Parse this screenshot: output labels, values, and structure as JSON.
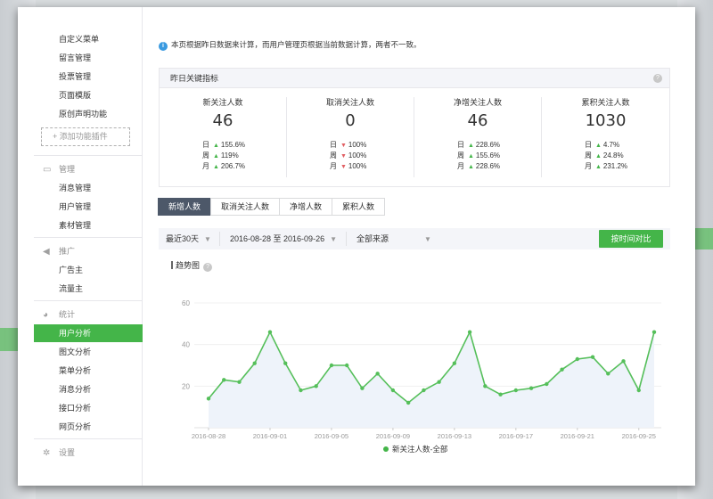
{
  "sidebar": {
    "top_items": [
      {
        "label": "自定义菜单"
      },
      {
        "label": "留言管理"
      },
      {
        "label": "投票管理"
      },
      {
        "label": "页面模版"
      },
      {
        "label": "原创声明功能"
      }
    ],
    "add_plugin_label": "+ 添加功能插件",
    "sections": [
      {
        "heading": "管理",
        "icon": "inbox-icon",
        "items": [
          {
            "label": "消息管理"
          },
          {
            "label": "用户管理"
          },
          {
            "label": "素材管理"
          }
        ]
      },
      {
        "heading": "推广",
        "icon": "megaphone-icon",
        "items": [
          {
            "label": "广告主"
          },
          {
            "label": "流量主"
          }
        ]
      },
      {
        "heading": "统计",
        "icon": "pie-chart-icon",
        "items": [
          {
            "label": "用户分析",
            "active": true
          },
          {
            "label": "图文分析"
          },
          {
            "label": "菜单分析"
          },
          {
            "label": "消息分析"
          },
          {
            "label": "接口分析"
          },
          {
            "label": "网页分析"
          }
        ]
      },
      {
        "heading": "设置",
        "icon": "gear-icon",
        "items": []
      }
    ]
  },
  "notice": "本页根据昨日数据来计算，而用户管理页根据当前数据计算，两者不一致。",
  "kpi": {
    "title": "昨日关键指标",
    "cards": [
      {
        "name": "新关注人数",
        "value": "46",
        "rows": [
          {
            "label": "日",
            "dir": "up",
            "pct": "155.6%"
          },
          {
            "label": "周",
            "dir": "up",
            "pct": "119%"
          },
          {
            "label": "月",
            "dir": "up",
            "pct": "206.7%"
          }
        ]
      },
      {
        "name": "取消关注人数",
        "value": "0",
        "rows": [
          {
            "label": "日",
            "dir": "down",
            "pct": "100%"
          },
          {
            "label": "周",
            "dir": "down",
            "pct": "100%"
          },
          {
            "label": "月",
            "dir": "down",
            "pct": "100%"
          }
        ]
      },
      {
        "name": "净增关注人数",
        "value": "46",
        "rows": [
          {
            "label": "日",
            "dir": "up",
            "pct": "228.6%"
          },
          {
            "label": "周",
            "dir": "up",
            "pct": "155.6%"
          },
          {
            "label": "月",
            "dir": "up",
            "pct": "228.6%"
          }
        ]
      },
      {
        "name": "累积关注人数",
        "value": "1030",
        "rows": [
          {
            "label": "日",
            "dir": "up",
            "pct": "4.7%"
          },
          {
            "label": "周",
            "dir": "up",
            "pct": "24.8%"
          },
          {
            "label": "月",
            "dir": "up",
            "pct": "231.2%"
          }
        ]
      }
    ]
  },
  "tabs": [
    {
      "label": "新增人数",
      "active": true
    },
    {
      "label": "取消关注人数"
    },
    {
      "label": "净增人数"
    },
    {
      "label": "累积人数"
    }
  ],
  "filters": {
    "period": "最近30天",
    "date_range": "2016-08-28 至 2016-09-26",
    "source": "全部来源",
    "compare_button": "按时间对比"
  },
  "trend_title": "趋势图",
  "colors": {
    "accent": "#44b549",
    "tab_active": "#4d5869",
    "line": "#55bf5a",
    "area": "#eef3fa"
  },
  "chart_data": {
    "type": "line",
    "title": "",
    "xlabel": "",
    "ylabel": "",
    "ylim": [
      0,
      60
    ],
    "yticks": [
      20,
      40,
      60
    ],
    "x": [
      "2016-08-28",
      "2016-08-29",
      "2016-08-30",
      "2016-08-31",
      "2016-09-01",
      "2016-09-02",
      "2016-09-03",
      "2016-09-04",
      "2016-09-05",
      "2016-09-06",
      "2016-09-07",
      "2016-09-08",
      "2016-09-09",
      "2016-09-10",
      "2016-09-11",
      "2016-09-12",
      "2016-09-13",
      "2016-09-14",
      "2016-09-15",
      "2016-09-16",
      "2016-09-17",
      "2016-09-18",
      "2016-09-19",
      "2016-09-20",
      "2016-09-21",
      "2016-09-22",
      "2016-09-23",
      "2016-09-24",
      "2016-09-25",
      "2016-09-26"
    ],
    "xtick_labels": [
      "2016-08-28",
      "2016-09-01",
      "2016-09-05",
      "2016-09-09",
      "2016-09-13",
      "2016-09-17",
      "2016-09-21",
      "2016-09-25"
    ],
    "series": [
      {
        "name": "新关注人数-全部",
        "values": [
          14,
          23,
          22,
          31,
          46,
          31,
          18,
          20,
          30,
          30,
          19,
          26,
          18,
          12,
          18,
          22,
          31,
          46,
          20,
          16,
          18,
          19,
          21,
          28,
          33,
          34,
          26,
          32,
          18,
          46
        ]
      }
    ],
    "grid": "horizontal",
    "legend": "bottom-center"
  }
}
